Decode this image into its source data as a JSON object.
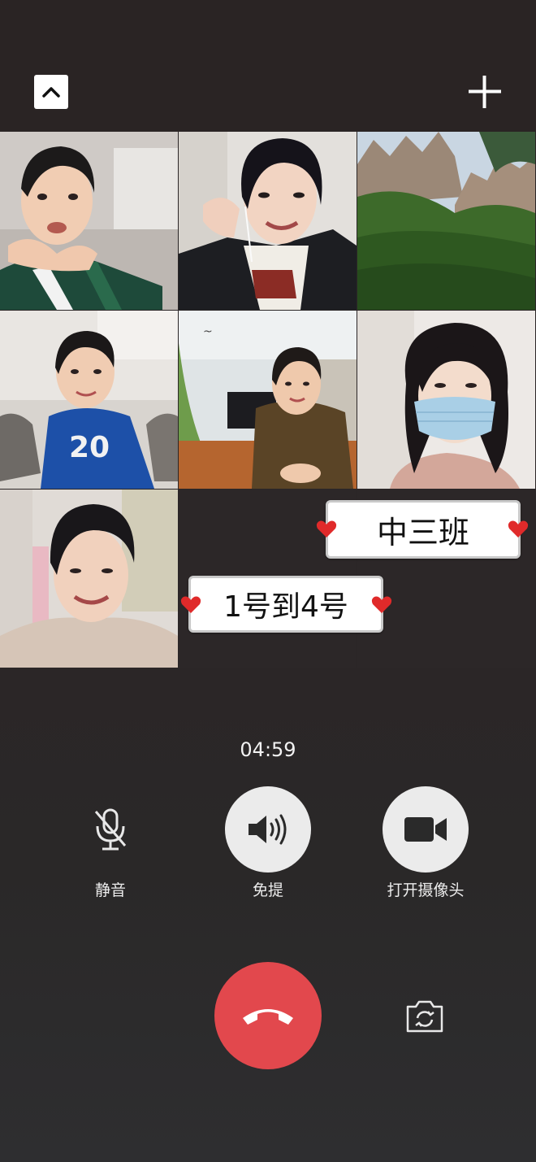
{
  "topbar": {
    "collapse_icon": "chevron-up-icon",
    "add_icon": "plus-icon"
  },
  "grid": {
    "participants": [
      {
        "description": "boy in green jacket",
        "icon": "video-feed"
      },
      {
        "description": "woman with earphones",
        "icon": "video-feed"
      },
      {
        "description": "mountain scenery",
        "icon": "video-feed"
      },
      {
        "description": "boy in blue sweater",
        "icon": "video-feed"
      },
      {
        "description": "boy in brown sweater",
        "icon": "video-feed"
      },
      {
        "description": "woman with mask",
        "icon": "video-feed"
      },
      {
        "description": "woman smiling",
        "icon": "video-feed"
      }
    ],
    "overlay_labels": {
      "class_name": "中三班",
      "number_range": "1号到4号"
    },
    "overlay_color": "#e02a2a"
  },
  "call": {
    "timer": "04:59",
    "controls": {
      "mute_label": "静音",
      "speaker_label": "免提",
      "camera_label": "打开摄像头"
    },
    "hangup_color": "#e2484d",
    "flip_icon": "camera-flip-icon"
  }
}
